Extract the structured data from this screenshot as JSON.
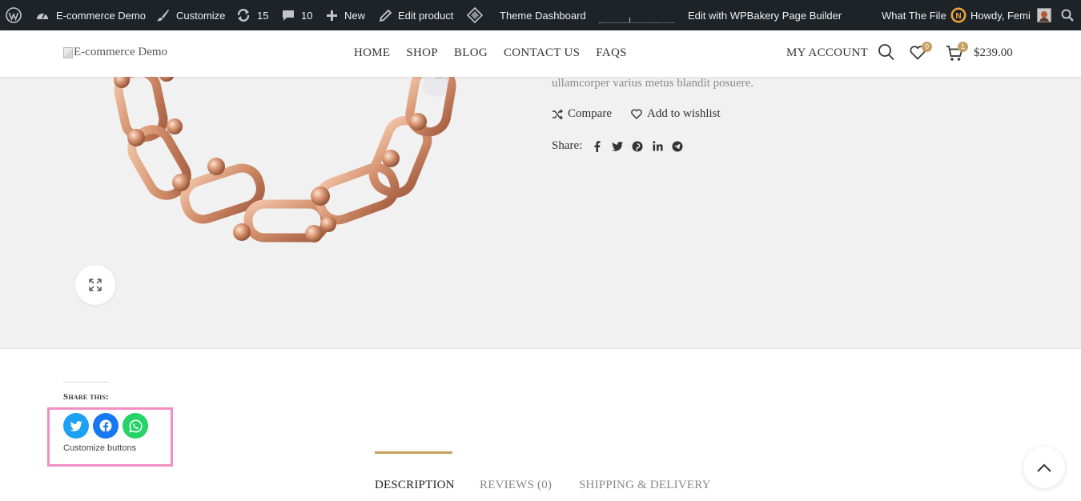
{
  "admin_bar": {
    "site_name": "E-commerce Demo",
    "customize": "Customize",
    "updates_count": "15",
    "comments_count": "10",
    "new_label": "New",
    "edit_product": "Edit product",
    "theme_dashboard": "Theme Dashboard",
    "wpbakery": "Edit with WPBakery Page Builder",
    "what_the_file": "What The File",
    "howdy": "Howdy, Femi"
  },
  "header": {
    "logo_alt": "E-commerce Demo",
    "nav": [
      "HOME",
      "SHOP",
      "BLOG",
      "CONTACT US",
      "FAQS"
    ],
    "my_account": "MY ACCOUNT",
    "wishlist_count": "0",
    "cart_count": "1",
    "cart_total": "$239.00"
  },
  "product": {
    "description_tail": "ullamcorper varius metus blandit posuere.",
    "compare": "Compare",
    "wishlist": "Add to wishlist",
    "share_label": "Share:",
    "share_icons": [
      "facebook-icon",
      "twitter-icon",
      "pinterest-icon",
      "linkedin-icon",
      "telegram-icon"
    ]
  },
  "share_this": {
    "title": "Share this:",
    "buttons": [
      "twitter",
      "facebook",
      "whatsapp"
    ],
    "customize": "Customize buttons",
    "colors": {
      "twitter": "#1da1f2",
      "facebook": "#1877f2",
      "whatsapp": "#25d366"
    }
  },
  "tabs": [
    "DESCRIPTION",
    "REVIEWS (0)",
    "SHIPPING & DELIVERY"
  ],
  "colors": {
    "admin_bar": "#1d2327",
    "accent_gold": "#c6a062",
    "highlight_pink": "#f48fc4",
    "product_bg": "#f1f1f1"
  }
}
